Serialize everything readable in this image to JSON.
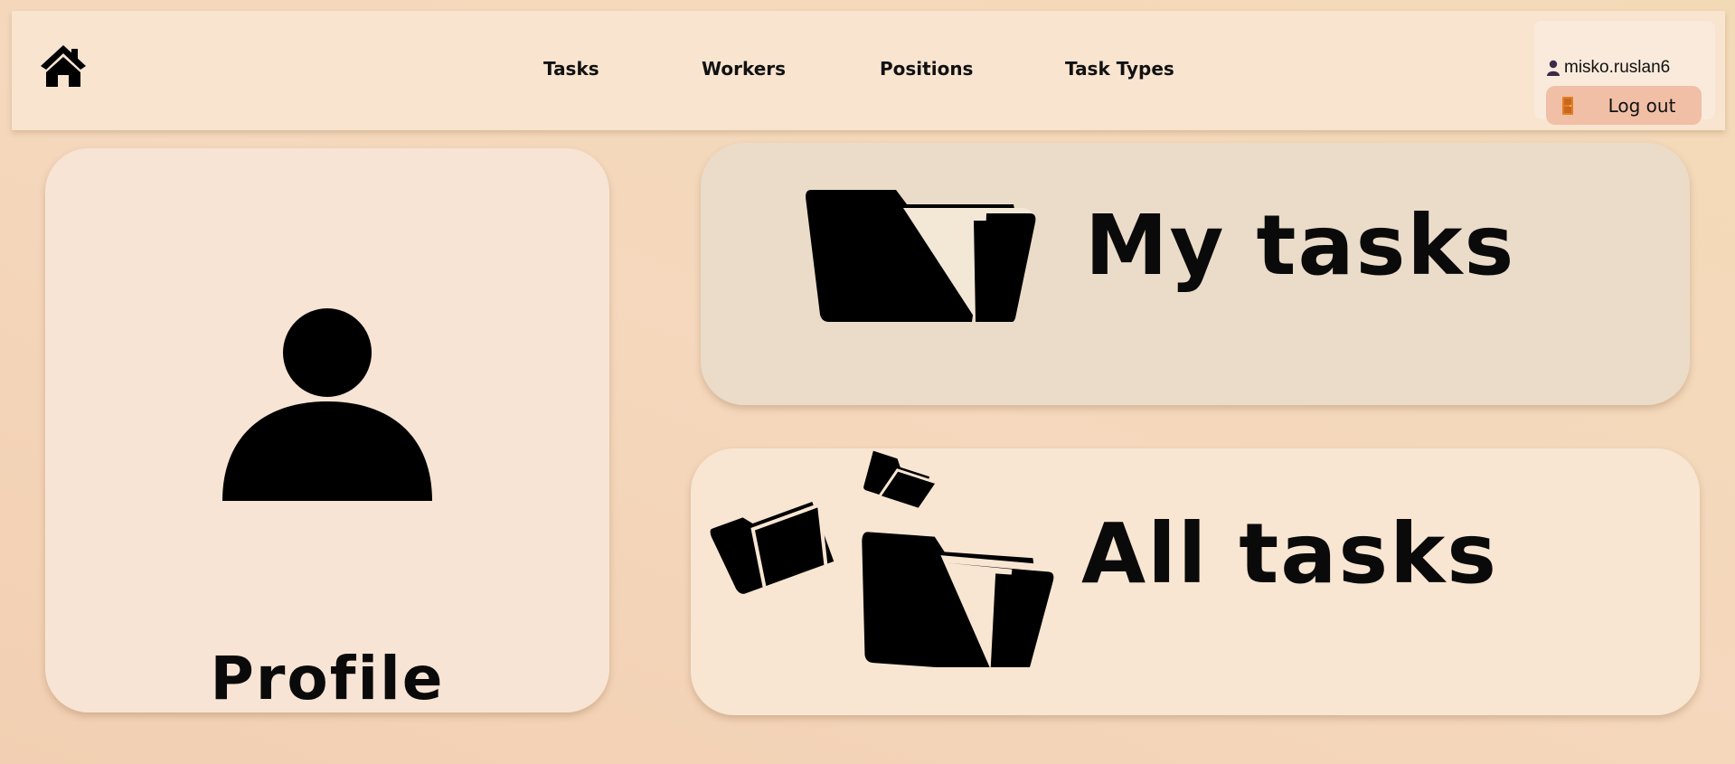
{
  "navbar": {
    "home_icon": "home-icon",
    "links": [
      {
        "label": "Tasks"
      },
      {
        "label": "Workers"
      },
      {
        "label": "Positions"
      },
      {
        "label": "Task Types"
      }
    ]
  },
  "user": {
    "icon": "user-icon",
    "username": "misko.ruslan6",
    "logout_icon": "door-icon",
    "logout_label": "Log out"
  },
  "cards": {
    "profile": {
      "label": "Profile",
      "icon": "person-icon"
    },
    "my_tasks": {
      "label": "My tasks",
      "icon": "folder-icon"
    },
    "all_tasks": {
      "label": "All tasks",
      "icon": "folders-icon"
    }
  },
  "colors": {
    "background": "#f3d5b8",
    "navbar": "#f8e4cf",
    "logout_button": "#f0bfa6",
    "profile_card": "#f8e4d4",
    "my_tasks_card": "#ebdcc9",
    "all_tasks_card": "#f8e6d2"
  }
}
